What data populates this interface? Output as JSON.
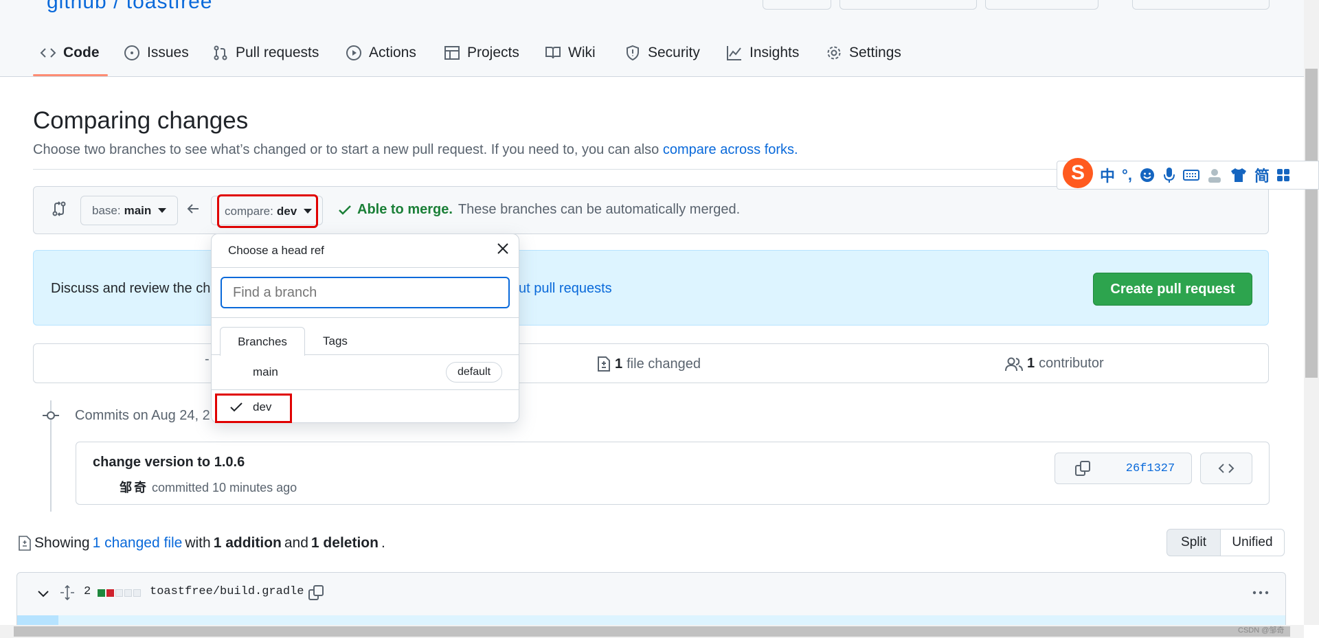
{
  "repo_partial": "github  /  toastfree",
  "tabs": [
    {
      "label": "Code"
    },
    {
      "label": "Issues"
    },
    {
      "label": "Pull requests"
    },
    {
      "label": "Actions"
    },
    {
      "label": "Projects"
    },
    {
      "label": "Wiki"
    },
    {
      "label": "Security"
    },
    {
      "label": "Insights"
    },
    {
      "label": "Settings"
    }
  ],
  "page": {
    "title": "Comparing changes",
    "subtitle": "Choose two branches to see what’s changed or to start a new pull request. If you need to, you can also ",
    "subtitle_link": "compare across forks",
    "subtitle_end": "."
  },
  "compare": {
    "base_label": "base:",
    "base_value": "main",
    "compare_label": "compare:",
    "compare_value": "dev",
    "merge_status": "Able to merge.",
    "merge_text": "These branches can be automatically merged."
  },
  "flash": {
    "text": "Discuss and review the ch",
    "link": "ut pull requests",
    "button": "Create pull request"
  },
  "summary": {
    "files_count": "1",
    "files_label": "file changed",
    "contributors_count": "1",
    "contributors_label": "contributor"
  },
  "commits": {
    "heading": "Commits on Aug 24, 2",
    "items": [
      {
        "title": "change version to 1.0.6",
        "author": "邹奇",
        "action": "committed 10 minutes ago",
        "sha": "26f1327"
      }
    ]
  },
  "showing": {
    "prefix": "Showing",
    "link": "1 changed file",
    "with": "with",
    "additions": "1 addition",
    "and": "and",
    "deletions": "1 deletion",
    "end": "."
  },
  "view_toggle": {
    "split": "Split",
    "unified": "Unified"
  },
  "file": {
    "count": "2",
    "name": "toastfree/build.gradle"
  },
  "dropdown": {
    "title": "Choose a head ref",
    "placeholder": "Find a branch",
    "tabs": {
      "branches": "Branches",
      "tags": "Tags"
    },
    "items": [
      {
        "name": "main",
        "badge": "default",
        "selected": false
      },
      {
        "name": "dev",
        "selected": true
      }
    ]
  },
  "ime": {
    "chars": [
      "中",
      "°,",
      "简"
    ]
  },
  "watermark": "CSDN @邹奇",
  "colors": {
    "accent_link": "#0969da",
    "success_green": "#2da44e",
    "merge_green": "#1a7f37",
    "tab_underline": "#fd8c73",
    "highlight_red": "#e00000",
    "flash_bg": "#ddf4ff"
  }
}
